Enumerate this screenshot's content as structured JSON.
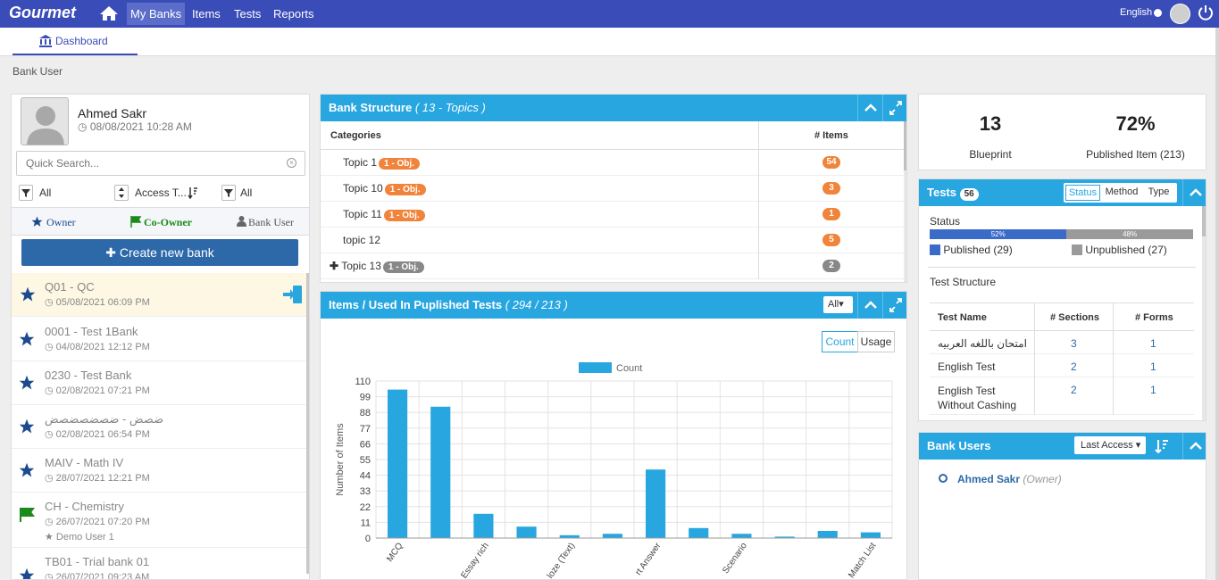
{
  "topbar": {
    "logo": "Gourmet",
    "nav": [
      "My Banks",
      "Items",
      "Tests",
      "Reports"
    ],
    "language": "English"
  },
  "tabs": {
    "dashboard": "Dashboard"
  },
  "breadcrumb": "Bank User",
  "profile": {
    "name": "Ahmed Sakr",
    "date": "08/08/2021 10:28 AM"
  },
  "search": {
    "placeholder": "Quick Search..."
  },
  "filters": {
    "left": "All",
    "sort": "Access T...",
    "right": "All"
  },
  "roles": {
    "owner": "Owner",
    "coowner": "Co-Owner",
    "bankuser": "Bank User"
  },
  "create_button": "Create new bank",
  "banks": [
    {
      "name": "Q01 - QC",
      "date": "05/08/2021 06:09 PM",
      "icon": "star-icon"
    },
    {
      "name": "0001 - Test 1Bank",
      "date": "04/08/2021 12:12 PM",
      "icon": "star-icon"
    },
    {
      "name": "0230 - Test Bank",
      "date": "02/08/2021 07:21 PM",
      "icon": "star-icon"
    },
    {
      "name": "ضصض - ضصضصضصض",
      "date": "02/08/2021 06:54 PM",
      "icon": "star-icon"
    },
    {
      "name": "MAIV - Math IV",
      "date": "28/07/2021 12:21 PM",
      "icon": "star-icon"
    },
    {
      "name": "CH - Chemistry",
      "date": "26/07/2021 07:20 PM",
      "owner": "Demo User 1",
      "icon": "flag-icon"
    },
    {
      "name": "TB01 - Trial bank 01",
      "date": "26/07/2021 09:23 AM",
      "icon": "star-icon"
    }
  ],
  "bank_structure": {
    "title": "Bank Structure",
    "subtitle": "( 13 - Topics )",
    "col_categories": "Categories",
    "col_items": "# Items",
    "topics": [
      {
        "name": "Topic 1",
        "badge": "1 - Obj.",
        "badge_color": "#f0843a",
        "count": "54",
        "count_color": "#f0843a"
      },
      {
        "name": "Topic 10",
        "badge": "1 - Obj.",
        "badge_color": "#f0843a",
        "count": "3",
        "count_color": "#f0843a"
      },
      {
        "name": "Topic 11",
        "badge": "1 - Obj.",
        "badge_color": "#f0843a",
        "count": "1",
        "count_color": "#f0843a"
      },
      {
        "name": "topic 12",
        "badge": "",
        "badge_color": "",
        "count": "5",
        "count_color": "#f0843a"
      },
      {
        "name": "Topic 13",
        "badge": "1 - Obj.",
        "badge_color": "#888888",
        "count": "2",
        "count_color": "#888888"
      }
    ]
  },
  "items_panel": {
    "title": "Items / Used In Puplished Tests",
    "subtitle": "( 294 / 213 )",
    "filter": "All",
    "seg_count": "Count",
    "seg_usage": "Usage"
  },
  "chart_data": {
    "type": "bar",
    "legend": "Count",
    "ylabel": "Number of Items",
    "yticks": [
      0,
      11,
      22,
      33,
      44,
      55,
      66,
      77,
      88,
      99,
      110
    ],
    "ylim": [
      0,
      110
    ],
    "categories": [
      "MCQ",
      "",
      "Essay rich",
      "",
      "Cloze (Text)",
      "",
      "Short Answer",
      "",
      "Scenario",
      "",
      "Match List"
    ],
    "category_labels": [
      "MCQ",
      "Essay rich",
      "loze (Text)",
      "rt Answer",
      "Scenario",
      "Match List"
    ],
    "values": [
      104,
      92,
      17,
      8,
      2,
      3,
      48,
      7,
      3,
      1,
      5,
      4
    ]
  },
  "stats": {
    "blueprint_value": "13",
    "blueprint_label": "Blueprint",
    "published_value": "72%",
    "published_label": "Published Item (213)"
  },
  "tests": {
    "title": "Tests",
    "count": "56",
    "tabs": [
      "Status",
      "Method",
      "Type"
    ],
    "status_label": "Status",
    "published_pct": 52,
    "unpublished_pct": 48,
    "published_pct_label": "52%",
    "unpublished_pct_label": "48%",
    "legend_published": "Published (29)",
    "legend_unpublished": "Unpublished (27)",
    "structure_label": "Test Structure",
    "columns": [
      "Test Name",
      "# Sections",
      "# Forms"
    ],
    "rows": [
      {
        "name": "امتحان باللغه العربيه",
        "sections": "3",
        "forms": "1"
      },
      {
        "name": "English Test",
        "sections": "2",
        "forms": "1"
      },
      {
        "name": "English Test Without Cashing",
        "sections": "2",
        "forms": "1"
      }
    ]
  },
  "bank_users": {
    "title": "Bank Users",
    "sort": "Last Access",
    "user_name": "Ahmed Sakr",
    "user_role": "(Owner)"
  }
}
